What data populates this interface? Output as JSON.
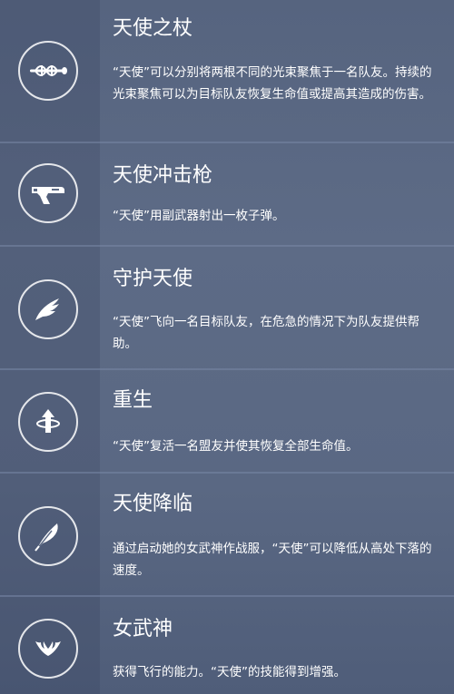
{
  "abilities": [
    {
      "name": "天使之杖",
      "description": "“天使”可以分别将两根不同的光束聚焦于一名队友。持续的光束聚焦可以为目标队友恢复生命值或提高其造成的伤害。",
      "icon": "caduceus-staff-icon"
    },
    {
      "name": "天使冲击枪",
      "description": "“天使”用副武器射出一枚子弹。",
      "icon": "blaster-pistol-icon"
    },
    {
      "name": "守护天使",
      "description": "“天使”飞向一名目标队友，在危急的情况下为队友提供帮助。",
      "icon": "wing-icon"
    },
    {
      "name": "重生",
      "description": "“天使”复活一名盟友并使其恢复全部生命值。",
      "icon": "resurrect-icon"
    },
    {
      "name": "天使降临",
      "description": "通过启动她的女武神作战服，“天使”可以降低从高处下落的速度。",
      "icon": "feather-icon"
    },
    {
      "name": "女武神",
      "description": "获得飞行的能力。“天使”的技能得到增强。",
      "icon": "valkyrie-wings-icon"
    }
  ]
}
